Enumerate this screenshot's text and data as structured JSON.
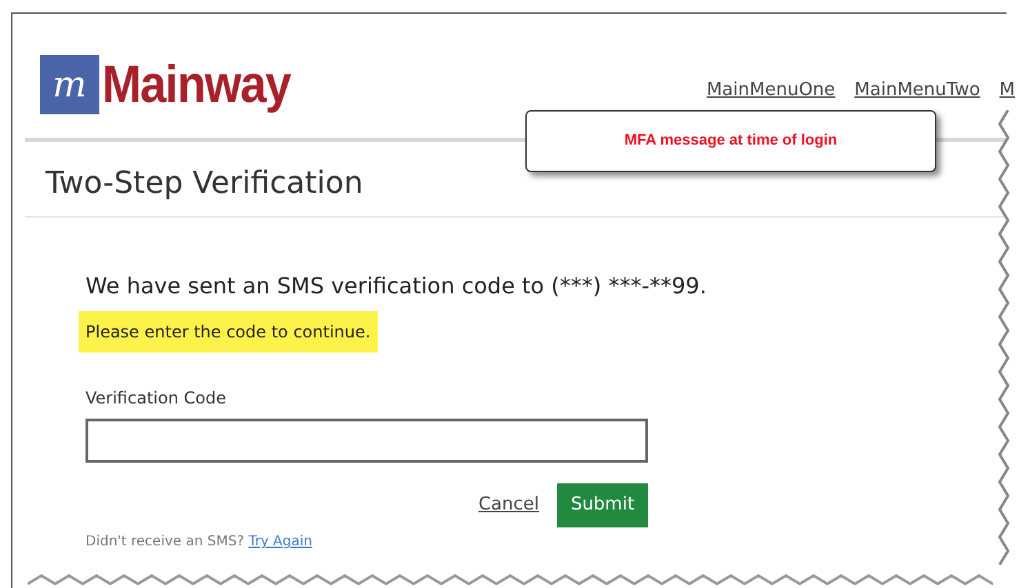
{
  "logo": {
    "mark": "m",
    "name": "Mainway"
  },
  "nav": [
    {
      "label": "MainMenuOne"
    },
    {
      "label": "MainMenuTwo"
    },
    {
      "label": "M"
    }
  ],
  "callout": {
    "text": "MFA message at time of login"
  },
  "title": "Two-Step Verification",
  "message": "We have sent an SMS verification code to (***) ***-**99.",
  "highlight": "Please enter the code to continue.",
  "field": {
    "label": "Verification Code"
  },
  "buttons": {
    "cancel": "Cancel",
    "submit": "Submit"
  },
  "footer": {
    "text": "Didn't receive an SMS?",
    "link": "Try Again"
  }
}
